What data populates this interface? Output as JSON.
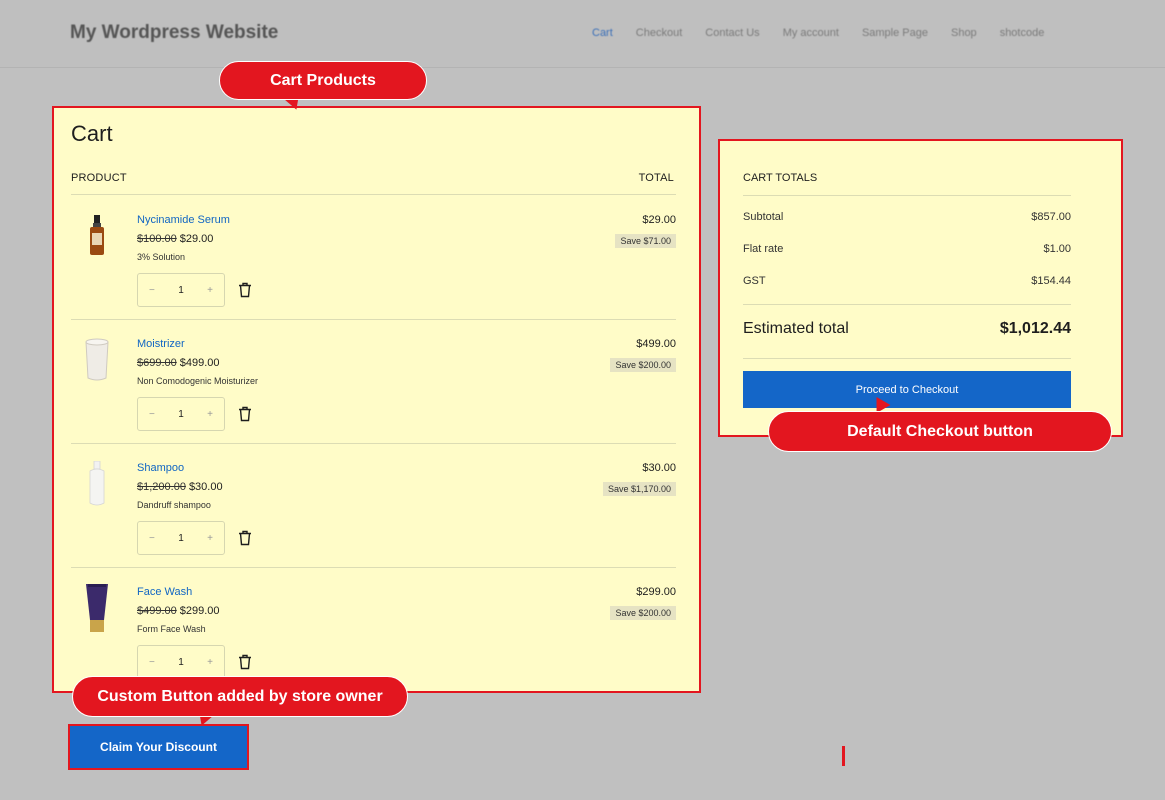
{
  "header": {
    "site_title": "My Wordpress Website",
    "nav": [
      "Cart",
      "Checkout",
      "Contact Us",
      "My account",
      "Sample Page",
      "Shop",
      "shotcode"
    ],
    "active_nav": "Cart"
  },
  "annotations": {
    "cart_products": "Cart Products",
    "default_checkout": "Default Checkout button",
    "custom_button": "Custom Button added by store owner"
  },
  "cart": {
    "heading": "Cart",
    "col_product": "PRODUCT",
    "col_total": "TOTAL",
    "items": [
      {
        "name": "Nycinamide Serum",
        "old_price": "$100.00",
        "price": "$29.00",
        "desc": "3% Solution",
        "qty": "1",
        "minus": "−",
        "plus": "+",
        "total": "$29.00",
        "save": "Save $71.00",
        "icon": "serum-bottle-icon"
      },
      {
        "name": "Moistrizer",
        "old_price": "$699.00",
        "price": "$499.00",
        "desc": "Non Comodogenic Moisturizer",
        "qty": "1",
        "minus": "−",
        "plus": "+",
        "total": "$499.00",
        "save": "Save $200.00",
        "icon": "moisturizer-jar-icon"
      },
      {
        "name": "Shampoo",
        "old_price": "$1,200.00",
        "price": "$30.00",
        "desc": "Dandruff shampoo",
        "qty": "1",
        "minus": "−",
        "plus": "+",
        "total": "$30.00",
        "save": "Save $1,170.00",
        "icon": "shampoo-bottle-icon"
      },
      {
        "name": "Face Wash",
        "old_price": "$499.00",
        "price": "$299.00",
        "desc": "Form Face Wash",
        "qty": "1",
        "minus": "−",
        "plus": "+",
        "total": "$299.00",
        "save": "Save $200.00",
        "icon": "face-wash-tube-icon"
      }
    ]
  },
  "totals": {
    "title": "CART TOTALS",
    "subtotal_label": "Subtotal",
    "subtotal_value": "$857.00",
    "flat_label": "Flat rate",
    "flat_value": "$1.00",
    "gst_label": "GST",
    "gst_value": "$154.44",
    "estimated_label": "Estimated total",
    "estimated_value": "$1,012.44",
    "checkout_button": "Proceed to Checkout"
  },
  "custom": {
    "claim_button": "Claim Your Discount"
  },
  "colors": {
    "accent_red": "#e3161f",
    "button_blue": "#1466c8",
    "panel_bg": "#fffcc8",
    "link_blue": "#1166c3"
  }
}
